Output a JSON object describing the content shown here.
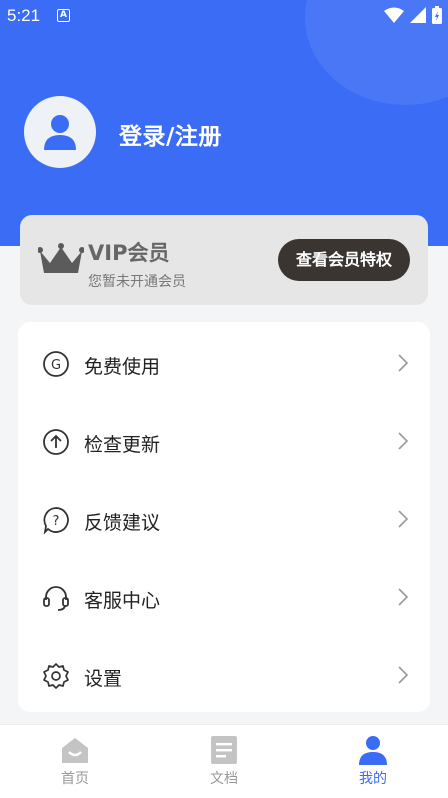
{
  "status_bar": {
    "time": "5:21",
    "notif_letter": "A"
  },
  "profile": {
    "login_label": "登录/注册"
  },
  "vip": {
    "title": "VIP会员",
    "subtitle": "您暂未开通会员",
    "button": "查看会员特权"
  },
  "menu": {
    "items": [
      {
        "label": "免费使用",
        "icon": "g-coin-icon"
      },
      {
        "label": "检查更新",
        "icon": "upload-arrow-icon"
      },
      {
        "label": "反馈建议",
        "icon": "question-bubble-icon"
      },
      {
        "label": "客服中心",
        "icon": "headset-icon"
      },
      {
        "label": "设置",
        "icon": "gear-icon"
      }
    ]
  },
  "tabbar": {
    "items": [
      {
        "label": "首页",
        "icon": "home-icon",
        "active": false
      },
      {
        "label": "文档",
        "icon": "document-icon",
        "active": false
      },
      {
        "label": "我的",
        "icon": "user-icon",
        "active": true
      }
    ]
  },
  "colors": {
    "primary": "#3a6cf5",
    "vip_button": "#3b3531",
    "vip_card": "#e6e6e6",
    "tab_inactive": "#999999"
  }
}
